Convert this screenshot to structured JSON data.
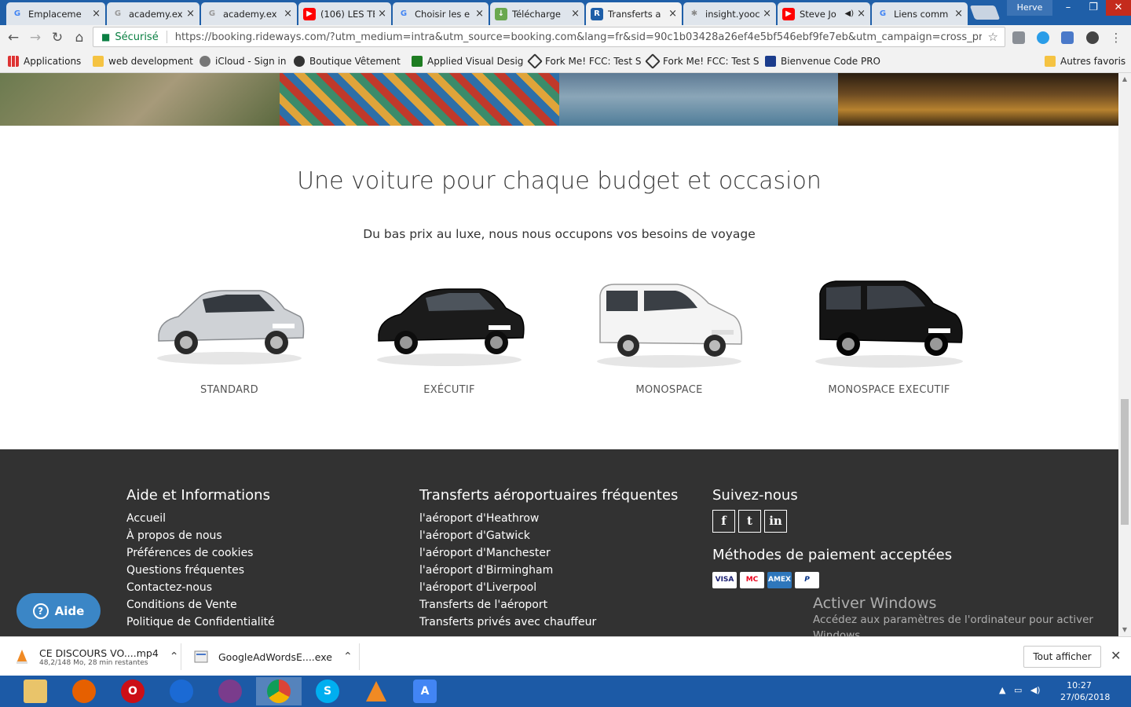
{
  "browser": {
    "tabs": [
      {
        "label": "Emplaceme",
        "favicon": "google-icon",
        "color": "#4285f4"
      },
      {
        "label": "academy.ex",
        "favicon": "google-icon",
        "color": "#999999"
      },
      {
        "label": "academy.ex",
        "favicon": "google-icon",
        "color": "#999999"
      },
      {
        "label": "(106) LES TE",
        "favicon": "youtube-icon",
        "color": "#ff0000"
      },
      {
        "label": "Choisir les e",
        "favicon": "google-icon",
        "color": "#4285f4"
      },
      {
        "label": "Télécharge",
        "favicon": "download-icon",
        "color": "#6aa84f"
      },
      {
        "label": "Transferts a",
        "favicon": "rideways-icon",
        "color": "#1f5fa8"
      },
      {
        "label": "insight.yooc",
        "favicon": "gear-icon",
        "color": "#888888"
      },
      {
        "label": "Steve Jo",
        "favicon": "youtube-icon",
        "color": "#ff0000"
      },
      {
        "label": "Liens comm",
        "favicon": "google-icon",
        "color": "#4285f4"
      }
    ],
    "profile": "Herve",
    "secure_label": "Sécurisé",
    "url": "https://booking.rideways.com/?utm_medium=intra&utm_source=booking.com&lang=fr&sid=90c1b03428a26ef4e5bf546ebf9fe7eb&utm_campaign=cross_product_..."
  },
  "bookmarks": [
    {
      "label": "Applications",
      "icon": "apps-icon"
    },
    {
      "label": "web development",
      "icon": "folder-icon"
    },
    {
      "label": "iCloud - Sign in",
      "icon": "apple-icon"
    },
    {
      "label": "Boutique Vêtement",
      "icon": "shop-icon"
    },
    {
      "label": "Applied Visual Desig",
      "icon": "design-icon"
    },
    {
      "label": "Fork Me! FCC: Test S",
      "icon": "codepen-icon"
    },
    {
      "label": "Fork Me! FCC: Test S",
      "icon": "codepen-icon"
    },
    {
      "label": "Bienvenue Code PRO",
      "icon": "codepro-icon"
    },
    {
      "label": "Autres favoris",
      "icon": "folder-icon"
    }
  ],
  "page": {
    "title": "Une voiture pour chaque budget et occasion",
    "subtitle": "Du bas prix au luxe, nous nous occupons vos besoins de voyage",
    "cars": [
      {
        "label": "STANDARD",
        "color": "#c9ccd0"
      },
      {
        "label": "EXÉCUTIF",
        "color": "#1a1a1a"
      },
      {
        "label": "MONOSPACE",
        "color": "#f2f2f2"
      },
      {
        "label": "MONOSPACE EXECUTIF",
        "color": "#151515"
      }
    ]
  },
  "footer": {
    "help_heading": "Aide et Informations",
    "help_links": [
      "Accueil",
      "À propos de nous",
      "Préférences de cookies",
      "Questions fréquentes",
      "Contactez-nous",
      "Conditions de Vente",
      "Politique de Confidentialité"
    ],
    "transfers_heading": "Transferts aéroportuaires fréquentes",
    "transfers_links": [
      "l'aéroport d'Heathrow",
      "l'aéroport d'Gatwick",
      "l'aéroport d'Manchester",
      "l'aéroport d'Birmingham",
      "l'aéroport d'Liverpool",
      "Transferts de l'aéroport",
      "Transferts privés avec chauffeur"
    ],
    "follow_heading": "Suivez-nous",
    "social": [
      {
        "label": "f",
        "icon": "facebook-icon"
      },
      {
        "label": "t",
        "icon": "twitter-icon"
      },
      {
        "label": "in",
        "icon": "linkedin-icon"
      }
    ],
    "payment_heading": "Méthodes de paiement acceptées",
    "payments": [
      {
        "label": "VISA",
        "color": "#1a1f71"
      },
      {
        "label": "MC",
        "color": "#eb001b"
      },
      {
        "label": "AMEX",
        "color": "#2e77bc"
      },
      {
        "label": "P",
        "color": "#003087"
      }
    ]
  },
  "help_button": {
    "label": "Aide"
  },
  "windows_activation": {
    "title": "Activer Windows",
    "text": "Accédez aux paramètres de l'ordinateur pour activer Windows."
  },
  "downloads": {
    "items": [
      {
        "name": "CE DISCOURS VO....mp4",
        "status": "48,2/148 Mo, 28 min restantes"
      },
      {
        "name": "GoogleAdWordsE....exe",
        "status": ""
      }
    ],
    "show_all": "Tout afficher"
  },
  "taskbar": {
    "time": "10:27",
    "date": "27/06/2018"
  }
}
